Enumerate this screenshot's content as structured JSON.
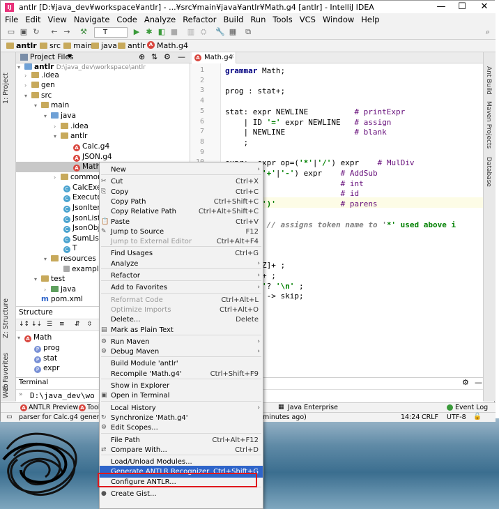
{
  "window": {
    "title": "antlr [D:¥java_dev¥workspace¥antlr] - ...¥src¥main¥java¥antlr¥Math.g4 [antlr] - IntelliJ IDEA",
    "minimize": "—",
    "maximize": "☐",
    "close": "✕"
  },
  "menu": [
    "File",
    "Edit",
    "View",
    "Navigate",
    "Code",
    "Analyze",
    "Refactor",
    "Build",
    "Run",
    "Tools",
    "VCS",
    "Window",
    "Help"
  ],
  "toolbar": {
    "run_config": "T"
  },
  "breadcrumb": [
    "antlr",
    "src",
    "main",
    "java",
    "antlr",
    "Math.g4"
  ],
  "project_panel": {
    "title": "Project Files",
    "root_label": "antlr",
    "root_path": "D:\\java_dev\\workspace\\antlr",
    "items": [
      ".idea",
      "gen",
      "src",
      "main",
      "java",
      ".idea",
      "antlr",
      "Calc.g4",
      "JSON.g4",
      "Math.g4",
      "common",
      "CalcExec",
      "Executor",
      "JsonItem",
      "JsonListe",
      "JsonObje",
      "SumListe",
      "T",
      "resources",
      "example.",
      "test",
      "java",
      "pom.xml"
    ]
  },
  "structure_panel": {
    "title": "Structure",
    "items": [
      "Math",
      "prog",
      "stat",
      "expr"
    ]
  },
  "terminal": {
    "title": "Terminal",
    "prompt": "D:\\java_dev\\wo"
  },
  "editor": {
    "tab": "Math.g4",
    "line_numbers": [
      "1",
      "2",
      "3",
      "4",
      "5",
      "6",
      "7",
      "8",
      "9",
      "10"
    ],
    "lines": [
      "grammar Math;",
      "",
      "prog : stat+;",
      "",
      "stat: expr NEWLINE          # printExpr",
      "    | ID '=' expr NEWLINE   # assign",
      "    | NEWLINE               # blank",
      "    ;",
      "",
      "expr:  expr op=('*'|'/') expr    # MulDiv",
      "     p=('+'|'-') expr    # AddSub",
      "                         # int",
      "                         # id",
      "     pr ')'              # parens",
      "",
      "     ' ; // assigns token name to '*' used above i",
      "     ' ;",
      "     ' ;",
      "     ' ;",
      "     zA-Z]+ ;",
      "     -9]+ ;",
      "     '\\r'? '\\n' ;",
      "     t]+ -> skip;"
    ]
  },
  "right_tabs": [
    "Ant Build",
    "Maven Projects",
    "Database"
  ],
  "left_tabs": [
    "1: Project",
    "Z: Structure",
    "2: Favorites",
    "Web"
  ],
  "bottom_tabs": [
    "ANTLR Preview",
    "Tool",
    "Java Enterprise",
    "Event Log"
  ],
  "status": {
    "message": "parser for Calc.g4 generated",
    "time_ago": "minutes ago)",
    "position": "14:24",
    "line_sep": "CRLF",
    "encoding": "UTF-8"
  },
  "context_menu": [
    {
      "label": "New",
      "sub": true
    },
    {
      "sep": true
    },
    {
      "label": "Cut",
      "shortcut": "Ctrl+X",
      "icon": "✂"
    },
    {
      "label": "Copy",
      "shortcut": "Ctrl+C",
      "icon": "⎘"
    },
    {
      "label": "Copy Path",
      "shortcut": "Ctrl+Shift+C"
    },
    {
      "label": "Copy Relative Path",
      "shortcut": "Ctrl+Alt+Shift+C"
    },
    {
      "label": "Paste",
      "shortcut": "Ctrl+V",
      "icon": "📋"
    },
    {
      "label": "Jump to Source",
      "shortcut": "F12",
      "icon": "✎"
    },
    {
      "label": "Jump to External Editor",
      "shortcut": "Ctrl+Alt+F4",
      "disabled": true
    },
    {
      "sep": true
    },
    {
      "label": "Find Usages",
      "shortcut": "Ctrl+G"
    },
    {
      "label": "Analyze",
      "sub": true
    },
    {
      "sep": true
    },
    {
      "label": "Refactor",
      "sub": true
    },
    {
      "sep": true
    },
    {
      "label": "Add to Favorites",
      "sub": true
    },
    {
      "sep": true
    },
    {
      "label": "Reformat Code",
      "shortcut": "Ctrl+Alt+L",
      "disabled": true
    },
    {
      "label": "Optimize Imports",
      "shortcut": "Ctrl+Alt+O",
      "disabled": true
    },
    {
      "label": "Delete...",
      "shortcut": "Delete"
    },
    {
      "label": "Mark as Plain Text",
      "icon": "▤"
    },
    {
      "sep": true
    },
    {
      "label": "Run Maven",
      "sub": true,
      "icon": "⚙"
    },
    {
      "label": "Debug Maven",
      "sub": true,
      "icon": "⚙"
    },
    {
      "sep": true
    },
    {
      "label": "Build Module 'antlr'"
    },
    {
      "label": "Recompile 'Math.g4'",
      "shortcut": "Ctrl+Shift+F9"
    },
    {
      "sep": true
    },
    {
      "label": "Show in Explorer"
    },
    {
      "label": "Open in Terminal",
      "icon": "▣"
    },
    {
      "sep": true
    },
    {
      "label": "Local History",
      "sub": true
    },
    {
      "label": "Synchronize 'Math.g4'",
      "icon": "↻"
    },
    {
      "label": "Edit Scopes...",
      "icon": "⚙"
    },
    {
      "sep": true
    },
    {
      "label": "File Path",
      "shortcut": "Ctrl+Alt+F12"
    },
    {
      "label": "Compare With...",
      "shortcut": "Ctrl+D",
      "icon": "⇄"
    },
    {
      "sep": true
    },
    {
      "label": "Load/Unload Modules..."
    },
    {
      "label": "Generate ANTLR Recognizer",
      "shortcut": "Ctrl+Shift+G",
      "highlight": true
    },
    {
      "label": "Configure ANTLR..."
    },
    {
      "sep": true
    },
    {
      "label": "Create Gist...",
      "icon": "●"
    }
  ],
  "colors": {
    "accent": "#2f65ca",
    "callout": "#e0171d",
    "antlr_icon": "#d9463e"
  }
}
